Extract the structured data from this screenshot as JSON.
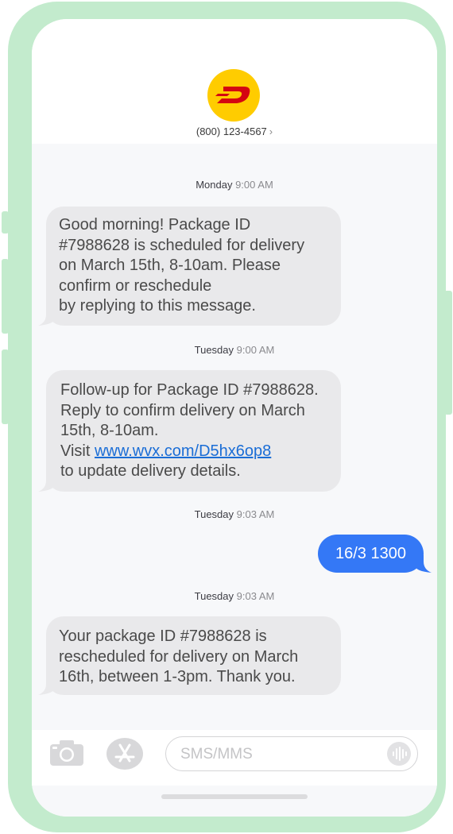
{
  "contact": {
    "phone": "(800) 123-4567",
    "chevron": "›",
    "avatar_icon": "carrier-logo-icon"
  },
  "messages": [
    {
      "day": "Monday",
      "time": "9:00 AM",
      "direction": "received",
      "lines": [
        "Good morning! Package ID",
        "#7988628 is scheduled for delivery",
        "on March 15th, 8-10am. Please",
        "confirm or reschedule",
        "by replying to this message."
      ]
    },
    {
      "day": "Tuesday",
      "time": "9:00 AM",
      "direction": "received",
      "lines": [
        "Follow-up for Package ID #7988628.",
        "Reply to confirm delivery on March",
        "15th, 8-10am."
      ],
      "visit_prefix": "Visit ",
      "link": "www.wvx.com/D5hx6op8",
      "last_line": "to update delivery details."
    },
    {
      "day": "Tuesday",
      "time": "9:03 AM",
      "direction": "sent",
      "text": "16/3 1300"
    },
    {
      "day": "Tuesday",
      "time": "9:03 AM",
      "direction": "received",
      "lines": [
        "Your package ID #7988628 is",
        "rescheduled for delivery on March",
        "16th, between 1-3pm. Thank you."
      ]
    }
  ],
  "input": {
    "placeholder": "SMS/MMS"
  },
  "colors": {
    "frame": "#c3ebcd",
    "sent_bubble": "#3478f6",
    "received_bubble": "#e9e9eb",
    "avatar": "#ffcc00",
    "logo_red": "#d40511",
    "link": "#1a6dd6"
  }
}
